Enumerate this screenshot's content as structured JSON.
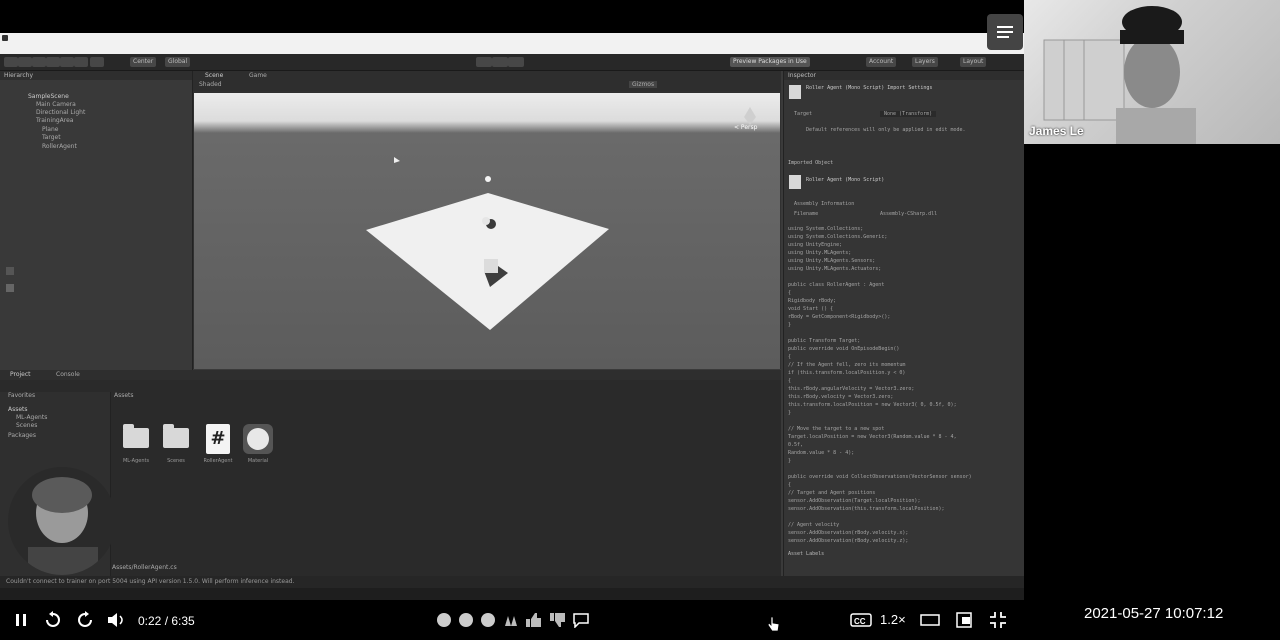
{
  "unity": {
    "toolbar_buttons": [
      "Center",
      "Global"
    ],
    "preview_packages": "Preview Packages in Use",
    "account": "Account",
    "layers": "Layers",
    "layout": "Layout",
    "hierarchy": {
      "tab": "Hierarchy",
      "items": [
        "SampleScene",
        "Main Camera",
        "Directional Light",
        "TrainingArea",
        "Plane",
        "Target",
        "RollerAgent"
      ]
    },
    "scene": {
      "tabs": [
        "Scene",
        "Game"
      ],
      "shading": "Shaded",
      "gizmos": "Gizmos",
      "persp": "< Persp"
    },
    "project": {
      "tabs": [
        "Project",
        "Console"
      ],
      "favorites": "Favorites",
      "tree": [
        "Assets",
        "ML-Agents",
        "Scenes",
        "Packages"
      ],
      "breadcrumb": "Assets",
      "assets": [
        "ML-Agents",
        "Scenes",
        "RollerAgent",
        "Material"
      ],
      "path": "Assets/RollerAgent.cs"
    },
    "inspector": {
      "tab": "Inspector",
      "header1": "Roller Agent (Mono Script) Import Settings",
      "target": "Target",
      "target_value": "None (Transform)",
      "note": "Default references will only be applied in edit mode.",
      "imported": "Imported Object",
      "header2": "Roller Agent (Mono Script)",
      "assembly_info": "Assembly Information",
      "filename_label": "Filename",
      "filename_value": "Assembly-CSharp.dll",
      "code": [
        "using System.Collections;",
        "using System.Collections.Generic;",
        "using UnityEngine;",
        "using Unity.MLAgents;",
        "using Unity.MLAgents.Sensors;",
        "using Unity.MLAgents.Actuators;",
        "",
        "public class RollerAgent : Agent",
        "{",
        "    Rigidbody rBody;",
        "    void Start () {",
        "        rBody = GetComponent<Rigidbody>();",
        "    }",
        "",
        "    public Transform Target;",
        "    public override void OnEpisodeBegin()",
        "    {",
        "       // If the Agent fell, zero its momentum",
        "        if (this.transform.localPosition.y < 0)",
        "        {",
        "            this.rBody.angularVelocity = Vector3.zero;",
        "            this.rBody.velocity = Vector3.zero;",
        "            this.transform.localPosition = new Vector3( 0, 0.5f, 0);",
        "        }",
        "",
        "        // Move the target to a new spot",
        "        Target.localPosition = new Vector3(Random.value * 8 - 4,",
        "                                           0.5f,",
        "                                           Random.value * 8 - 4);",
        "    }",
        "",
        "    public override void CollectObservations(VectorSensor sensor)",
        "    {",
        "        // Target and Agent positions",
        "        sensor.AddObservation(Target.localPosition);",
        "        sensor.AddObservation(this.transform.localPosition);",
        "",
        "        // Agent velocity",
        "        sensor.AddObservation(rBody.velocity.x);",
        "        sensor.AddObservation(rBody.velocity.z);"
      ],
      "asset_labels": "Asset Labels"
    },
    "status": "Couldn't connect to trainer on port 5004 using API version 1.5.0. Will perform inference instead."
  },
  "webcam": {
    "name": "James Le"
  },
  "player": {
    "time": "0:22 / 6:35",
    "speed": "1.2×"
  },
  "datetime": "2021-05-27  10:07:12",
  "colors": {
    "background": "#000000",
    "editor_dark": "#3a3a3a",
    "white": "#ffffff"
  }
}
